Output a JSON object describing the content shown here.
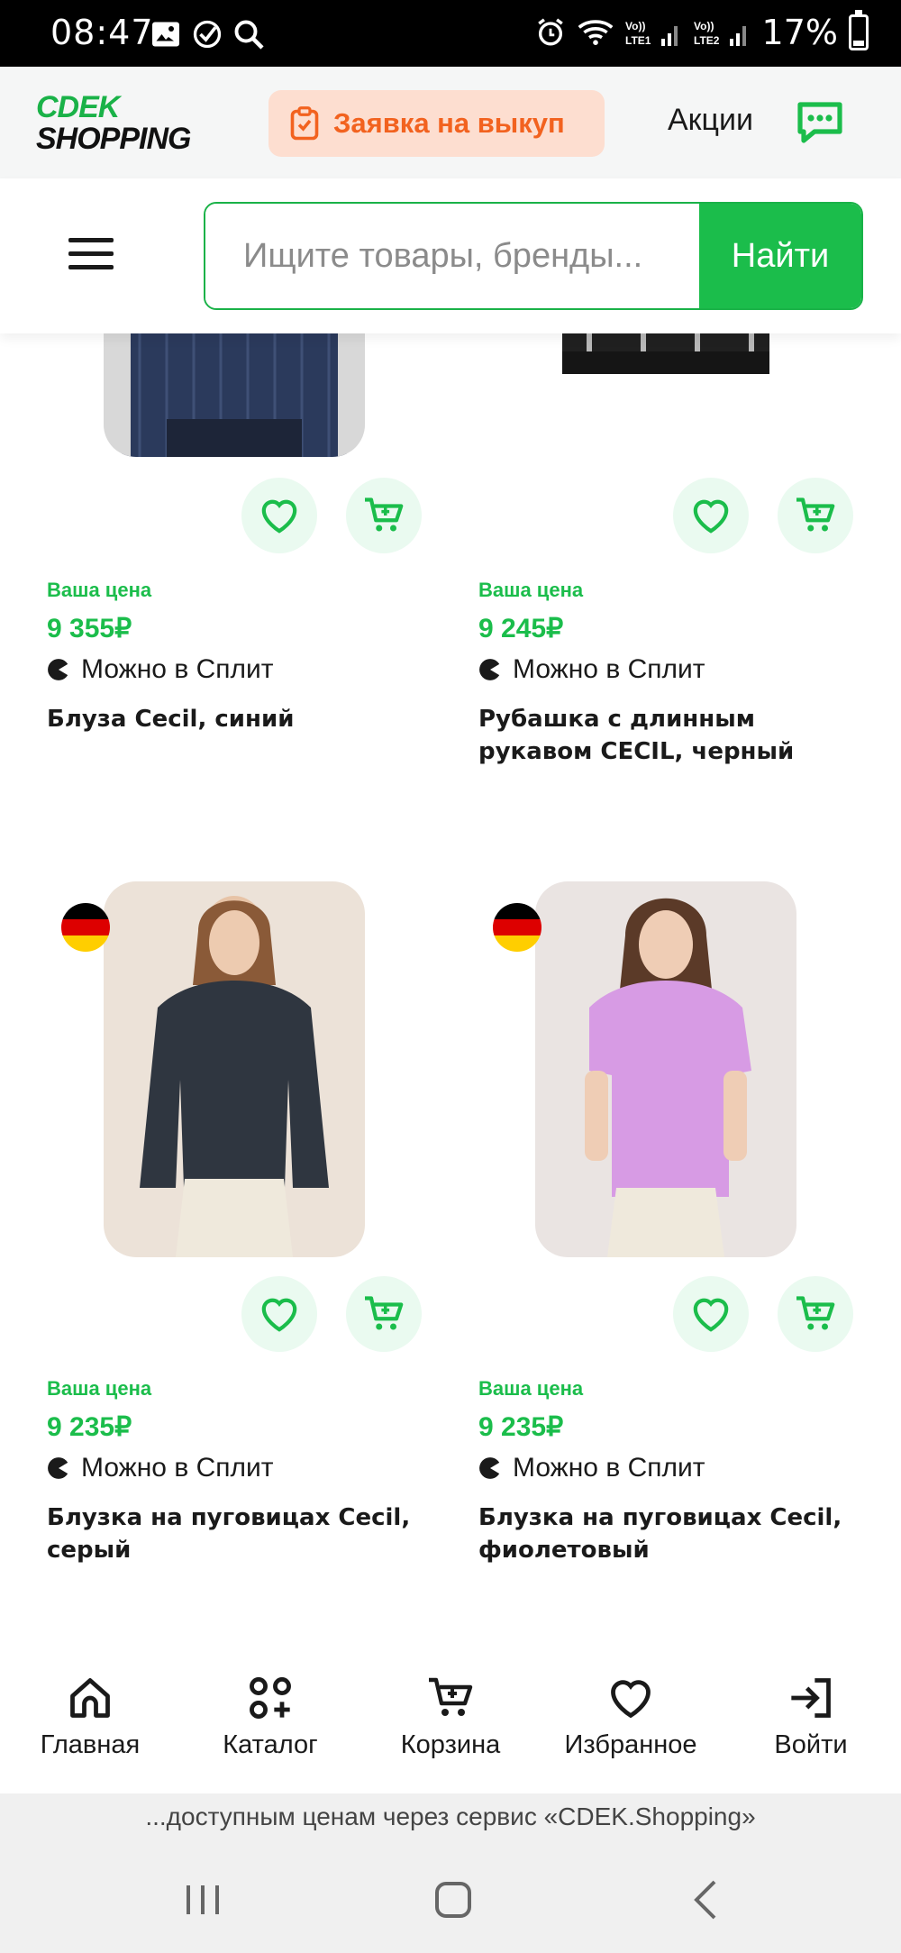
{
  "status_bar": {
    "time": "08:47",
    "battery": "17%",
    "battery_level": 0.17,
    "icons": [
      "gallery-icon",
      "check-circle-icon",
      "search-icon",
      "alarm-icon",
      "wifi-icon",
      "volte-lte1-icon",
      "volte-lte2-icon",
      "battery-icon"
    ]
  },
  "header": {
    "logo_line1": "CDEK",
    "logo_line2": "SHOPPING",
    "order_button": "Заявка на выкуп",
    "promo_link": "Акции"
  },
  "search": {
    "placeholder": "Ищите товары, бренды...",
    "button": "Найти"
  },
  "products": [
    {
      "price_label": "Ваша цена",
      "price": "9 355₽",
      "split_label": "Можно в Сплит",
      "title": "Блуза Cecil, синий",
      "color": "#2b3a5c"
    },
    {
      "price_label": "Ваша цена",
      "price": "9 245₽",
      "split_label": "Можно в Сплит",
      "title": "Рубашка с длинным рукавом CECIL, черный",
      "color": "#202020"
    },
    {
      "price_label": "Ваша цена",
      "price": "9 235₽",
      "split_label": "Можно в Сплит",
      "title": "Блузка на пуговицах Cecil, серый",
      "color": "#2f3640"
    },
    {
      "price_label": "Ваша цена",
      "price": "9 235₽",
      "split_label": "Можно в Сплит",
      "title": "Блузка на пуговицах Cecil, фиолетовый",
      "color": "#d79be4"
    }
  ],
  "bottom_nav": [
    {
      "label": "Главная",
      "icon": "home-icon"
    },
    {
      "label": "Каталог",
      "icon": "catalog-icon"
    },
    {
      "label": "Корзина",
      "icon": "cart-icon"
    },
    {
      "label": "Избранное",
      "icon": "heart-icon"
    },
    {
      "label": "Войти",
      "icon": "login-icon"
    }
  ],
  "url_footer": "...доступным ценам через сервис «CDEK.Shopping»",
  "colors": {
    "brand_green": "#1bbd4b",
    "accent_orange": "#f2621f",
    "orange_bg": "#fdded0"
  }
}
